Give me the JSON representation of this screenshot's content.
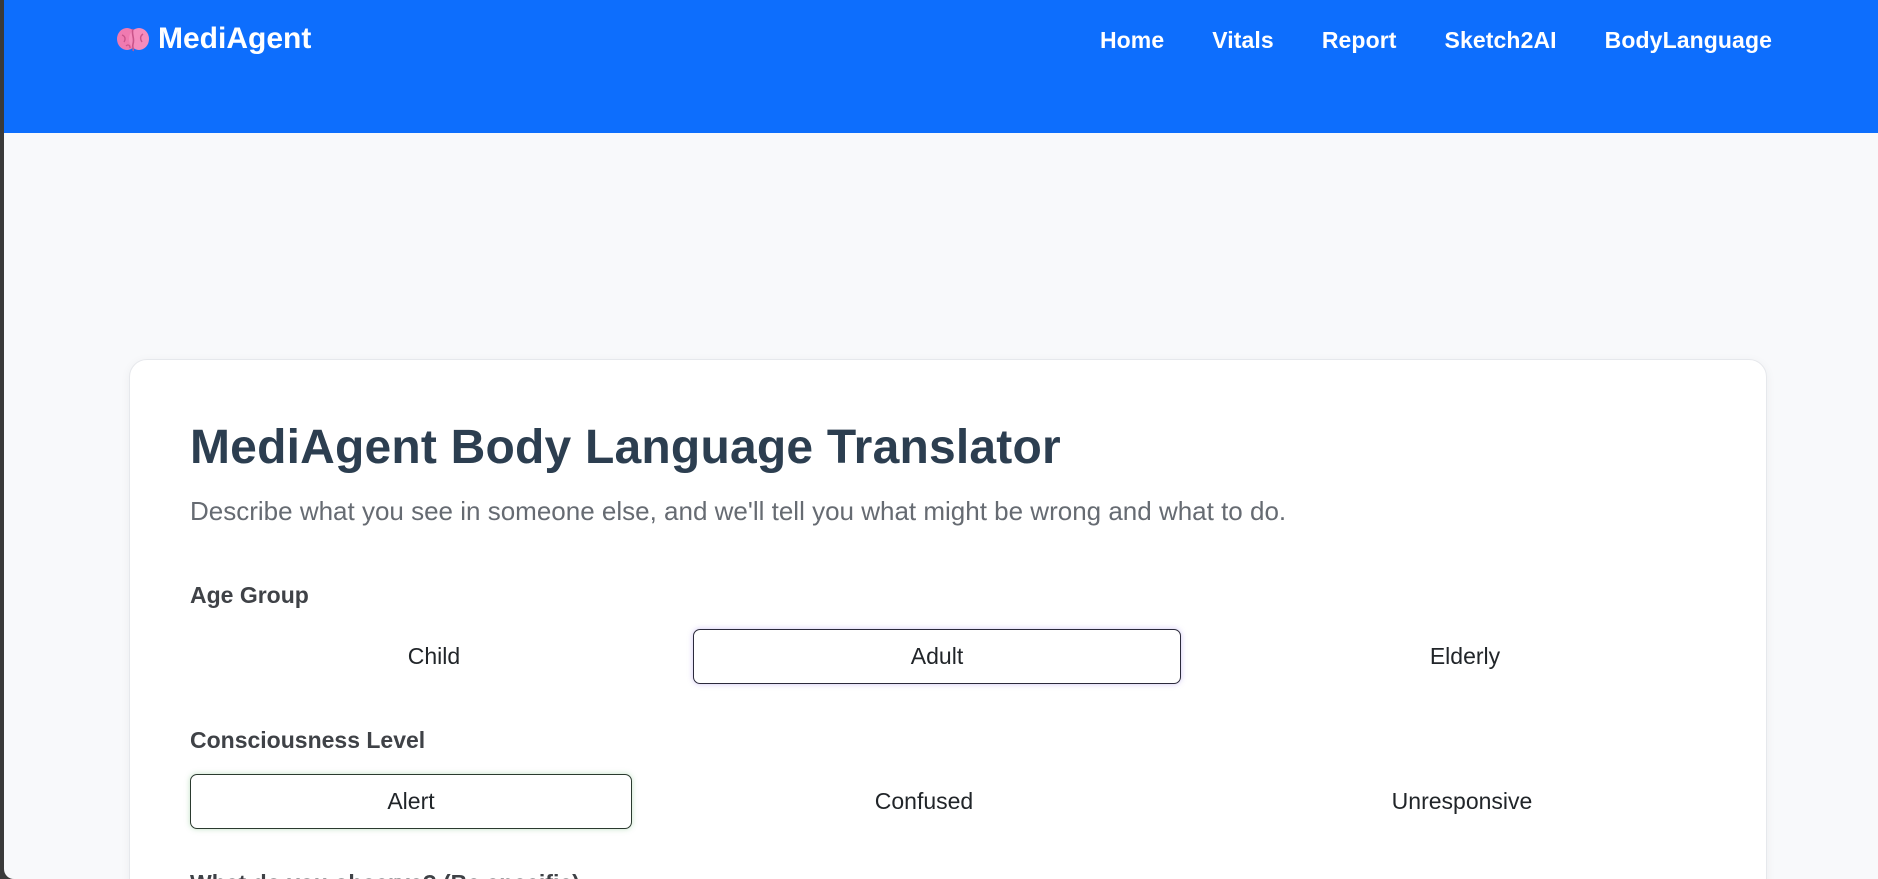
{
  "navbar": {
    "brand": "MediAgent",
    "brand_icon": "brain-icon",
    "links": [
      "Home",
      "Vitals",
      "Report",
      "Sketch2AI",
      "BodyLanguage"
    ],
    "background": "#0d6efd"
  },
  "main": {
    "title": "MediAgent Body Language Translator",
    "subtitle": "Describe what you see in someone else, and we'll tell you what might be wrong and what to do.",
    "age_group": {
      "label": "Age Group",
      "options": [
        "Child",
        "Adult",
        "Elderly"
      ],
      "selected": "Adult"
    },
    "consciousness": {
      "label": "Consciousness Level",
      "options": [
        "Alert",
        "Confused",
        "Unresponsive"
      ],
      "selected": "Alert"
    },
    "next_label_partial": "What do you observe? (Be specific)"
  }
}
